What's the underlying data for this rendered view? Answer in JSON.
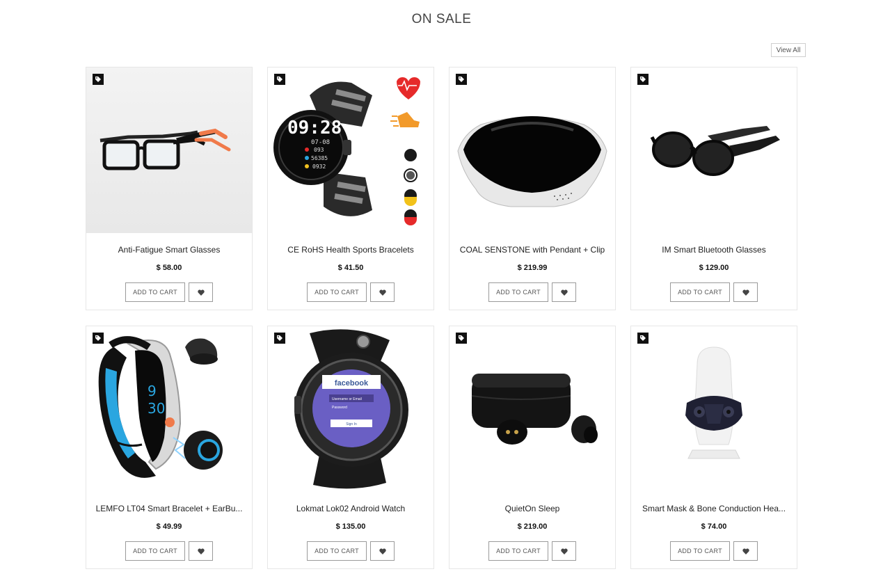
{
  "section": {
    "title": "ON SALE",
    "view_all_label": "View All"
  },
  "products": [
    {
      "name": "Anti-Fatigue Smart Glasses",
      "price": "$ 58.00",
      "add_to_cart": "ADD TO CART",
      "image_icon": "smart-glasses"
    },
    {
      "name": "CE RoHS Health Sports Bracelets",
      "price": "$ 41.50",
      "add_to_cart": "ADD TO CART",
      "image_icon": "smartwatch"
    },
    {
      "name": "COAL SENSTONE with Pendant + Clip",
      "price": "$ 219.99",
      "add_to_cart": "ADD TO CART",
      "image_icon": "pendant-device"
    },
    {
      "name": "IM Smart Bluetooth Glasses",
      "price": "$ 129.00",
      "add_to_cart": "ADD TO CART",
      "image_icon": "sunglasses"
    },
    {
      "name": "LEMFO LT04 Smart Bracelet + EarBu...",
      "price": "$ 49.99",
      "add_to_cart": "ADD TO CART",
      "image_icon": "fitness-bracelet"
    },
    {
      "name": "Lokmat Lok02 Android Watch",
      "price": "$ 135.00",
      "add_to_cart": "ADD TO CART",
      "image_icon": "android-watch"
    },
    {
      "name": "QuietOn Sleep",
      "price": "$ 219.00",
      "add_to_cart": "ADD TO CART",
      "image_icon": "earbuds-case"
    },
    {
      "name": "Smart Mask & Bone Conduction Hea...",
      "price": "$ 74.00",
      "add_to_cart": "ADD TO CART",
      "image_icon": "smart-mask"
    }
  ],
  "watch_screen": {
    "time": "09:28",
    "date": "07-08",
    "stat1": "093",
    "stat2": "56385",
    "stat3": "0932"
  },
  "android_screen": {
    "app": "facebook",
    "field1": "Username or Email",
    "field2": "Password",
    "button": "Sign In"
  },
  "colors": {
    "badge": "#111111",
    "border": "#e6e6e6",
    "button_border": "#9a9a9a",
    "accent_blue": "#2aa6e0",
    "accent_orange": "#f07a4a",
    "heart_red": "#e62a2a"
  }
}
